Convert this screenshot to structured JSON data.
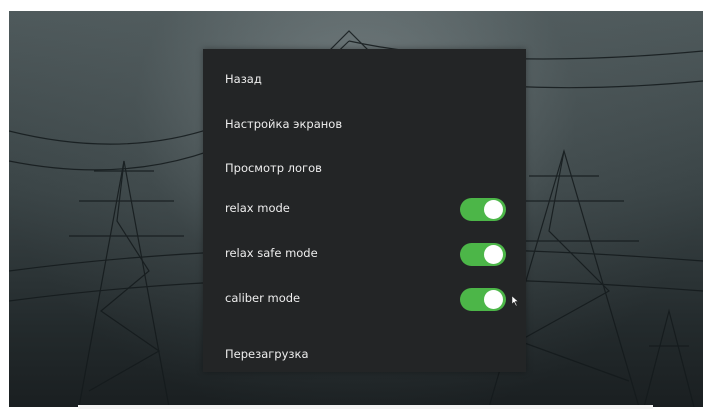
{
  "menu": {
    "items": [
      {
        "label": "Назад"
      },
      {
        "label": "Настройка экранов"
      },
      {
        "label": "Просмотр логов"
      },
      {
        "label": "relax mode",
        "toggle": true,
        "on": true
      },
      {
        "label": "relax safe mode",
        "toggle": true,
        "on": true
      },
      {
        "label": "caliber mode",
        "toggle": true,
        "on": true
      },
      {
        "label": "Перезагрузка"
      }
    ]
  },
  "colors": {
    "menu_background": "#232526",
    "toggle_on": "#4cb648",
    "toggle_knob": "#ffffff",
    "text": "#eeeeee"
  },
  "icons": {
    "cursor": "mouse-pointer-icon"
  }
}
